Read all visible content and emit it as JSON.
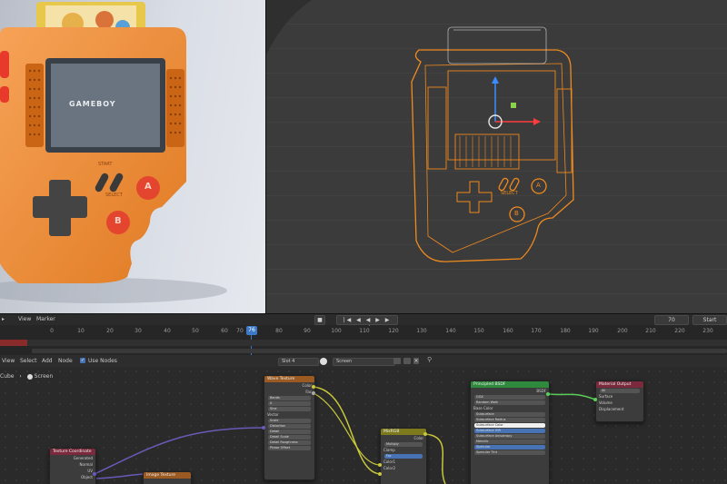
{
  "render": {
    "screen_logo_text": "GAMEBOY",
    "label_start": "START",
    "label_select": "SELECT",
    "btn_a": "A",
    "btn_b": "B"
  },
  "viewport3d": {
    "label_select": "SELECT",
    "btn_a": "A",
    "btn_b": "B"
  },
  "timeline": {
    "menu": [
      "View",
      "Marker"
    ],
    "current_frame": "76",
    "ticks": [
      "0",
      "10",
      "20",
      "30",
      "40",
      "50",
      "60",
      "70",
      "80",
      "90",
      "100",
      "110",
      "120",
      "130",
      "140",
      "150",
      "160",
      "170",
      "180",
      "190",
      "200",
      "210",
      "220",
      "230"
    ],
    "end_field": "70",
    "start_label": "Start"
  },
  "node_editor": {
    "menu": [
      "View",
      "Select",
      "Add",
      "Node"
    ],
    "use_nodes_label": "Use Nodes",
    "slot": "Slot 4",
    "material": "Screen",
    "breadcrumb_object": "Cube",
    "breadcrumb_material": "Screen",
    "nodes": {
      "texcoord": {
        "title": "Texture Coordinate",
        "outputs": [
          "Generated",
          "Normal",
          "UV",
          "Object"
        ]
      },
      "image": {
        "title": "Image Texture"
      },
      "wave": {
        "title": "Wave Texture",
        "outputs": [
          "Color",
          "Fac"
        ],
        "fields": [
          "Bands",
          "X",
          "Sine",
          "Vector",
          "Scale",
          "Distortion",
          "Detail",
          "Detail Scale",
          "Detail Roughness",
          "Phase Offset"
        ]
      },
      "mix": {
        "title": "MixRGB",
        "mode": "Multiply",
        "clamp": "Clamp",
        "rows": [
          "Color",
          "Fac",
          "Color1",
          "Color2"
        ]
      },
      "bsdf": {
        "title": "Principled BSDF",
        "output": "BSDF",
        "fields": [
          "GGX",
          "Random Walk",
          "Base Color",
          "Subsurface",
          "Subsurface Radius",
          "Subsurface Color",
          "Subsurface IOR",
          "Subsurface Anisotropy",
          "Metallic",
          "Specular",
          "Specular Tint"
        ]
      },
      "output": {
        "title": "Material Output",
        "target": "All",
        "rows": [
          "Surface",
          "Volume",
          "Displacement"
        ]
      }
    }
  }
}
